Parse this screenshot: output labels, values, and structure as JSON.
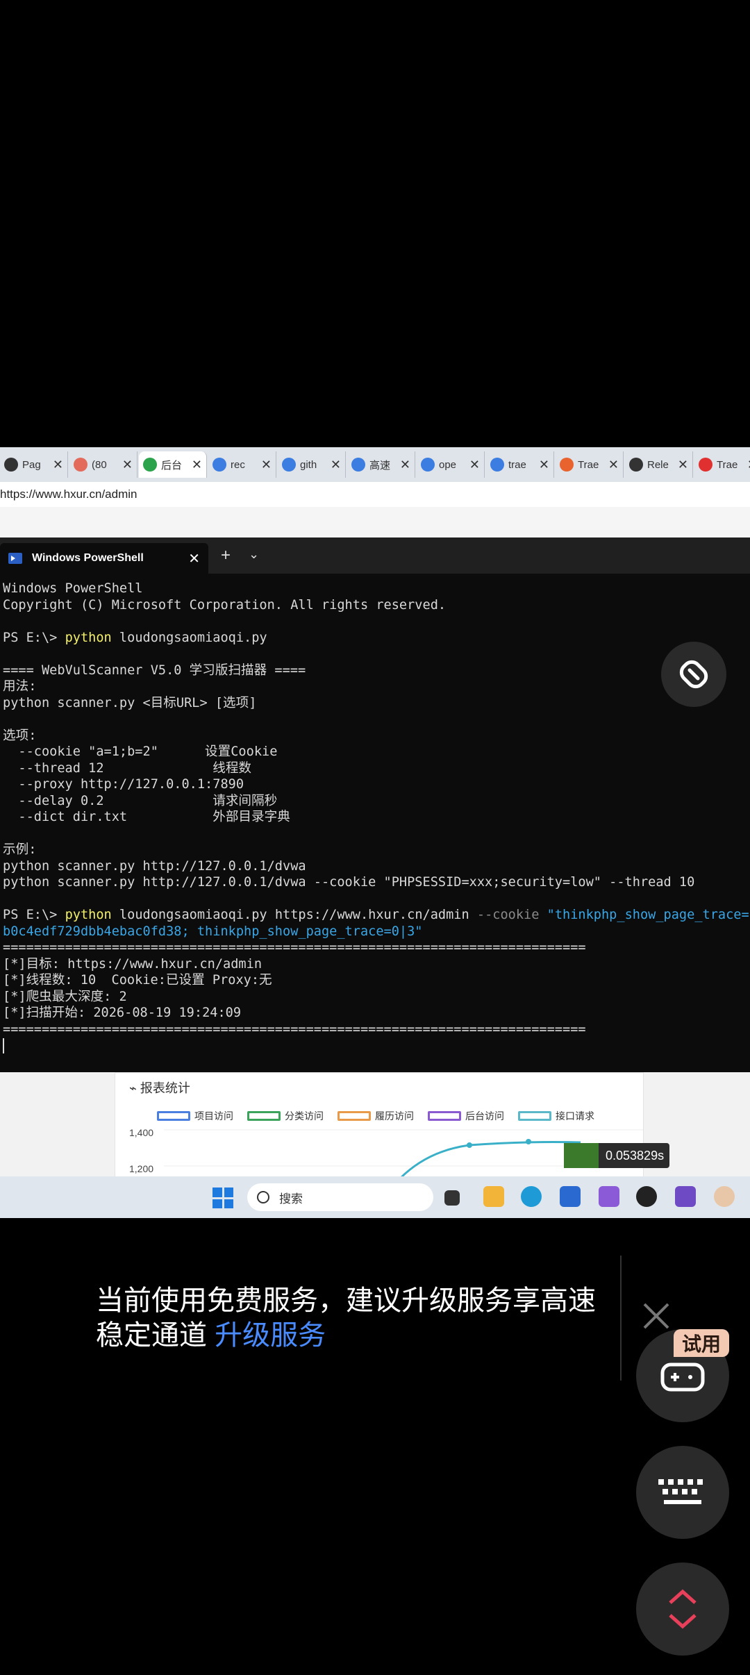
{
  "browser": {
    "tabs": [
      {
        "title": "Pag",
        "icon": "github-icon",
        "color": "#333333"
      },
      {
        "title": "(80",
        "icon": "flower-icon",
        "color": "#e36b5b"
      },
      {
        "title": "后台",
        "icon": "tp-icon",
        "color": "#2ba24c",
        "active": true
      },
      {
        "title": "rec",
        "icon": "search-icon",
        "color": "#3b7de0"
      },
      {
        "title": "gith",
        "icon": "search-icon",
        "color": "#3b7de0"
      },
      {
        "title": "高速",
        "icon": "search-icon",
        "color": "#3b7de0"
      },
      {
        "title": "ope",
        "icon": "search-icon",
        "color": "#3b7de0"
      },
      {
        "title": "trae",
        "icon": "search-icon",
        "color": "#3b7de0"
      },
      {
        "title": "Trae",
        "icon": "c-icon",
        "color": "#e8632e"
      },
      {
        "title": "Rele",
        "icon": "github-icon",
        "color": "#333333"
      },
      {
        "title": "Trae",
        "icon": "g-icon",
        "color": "#e03030"
      }
    ],
    "url": "https://www.hxur.cn/admin"
  },
  "powershell": {
    "tab_title": "Windows PowerShell",
    "new_tab": "+",
    "dropdown": "⌄",
    "close": "✕",
    "lines": {
      "l1": "Windows PowerShell",
      "l2": "Copyright (C) Microsoft Corporation. All rights reserved.",
      "prompt1": "PS E:\\> ",
      "cmd1": "python",
      "arg1": " loudongsaomiaoqi.py",
      "banner": "==== WebVulScanner V5.0 学习版扫描器 ====",
      "usage_h": "用法:",
      "usage": "python scanner.py <目标URL> [选项]",
      "opts_h": "选项:",
      "o1": "  --cookie \"a=1;b=2\"      设置Cookie",
      "o2": "  --thread 12              线程数",
      "o3": "  --proxy http://127.0.0.1:7890",
      "o4": "  --delay 0.2              请求间隔秒",
      "o5": "  --dict dir.txt           外部目录字典",
      "ex_h": "示例:",
      "ex1": "python scanner.py http://127.0.0.1/dvwa",
      "ex2": "python scanner.py http://127.0.0.1/dvwa --cookie \"PHPSESSID=xxx;security=low\" --thread 10",
      "prompt2": "PS E:\\> ",
      "cmd2": "python",
      "arg2": " loudongsaomiaoqi.py https://www.hxur.cn/admin ",
      "param2": "--cookie ",
      "str2a": "\"thinkphp_show_page_trace=",
      "str2b": "b0c4edf729dbb4ebac0fd38; thinkphp_show_page_trace=0|3\"",
      "sep": "===========================================================================",
      "r1": "[*]目标: https://www.hxur.cn/admin",
      "r2": "[*]线程数: 10  Cookie:已设置 Proxy:无",
      "r3": "[*]爬虫最大深度: 2",
      "r4": "[*]扫描开始: 2026-08-19 19:24:09"
    }
  },
  "report": {
    "title": "报表统计",
    "legend": [
      {
        "label": "项目访问",
        "color": "#4a7fe0"
      },
      {
        "label": "分类访问",
        "color": "#3ba35a"
      },
      {
        "label": "履历访问",
        "color": "#e89a4a"
      },
      {
        "label": "后台访问",
        "color": "#8a5ad0"
      },
      {
        "label": "接口请求",
        "color": "#5ab8c8"
      }
    ],
    "y1": "1,400",
    "y2": "1,200",
    "timer": "0.053829s"
  },
  "taskbar": {
    "search_placeholder": "搜索"
  },
  "overlay": {
    "message": "当前使用免费服务，建议升级服务享高速稳定通道 ",
    "upgrade_link": "升级服务",
    "trial_badge": "试用"
  }
}
